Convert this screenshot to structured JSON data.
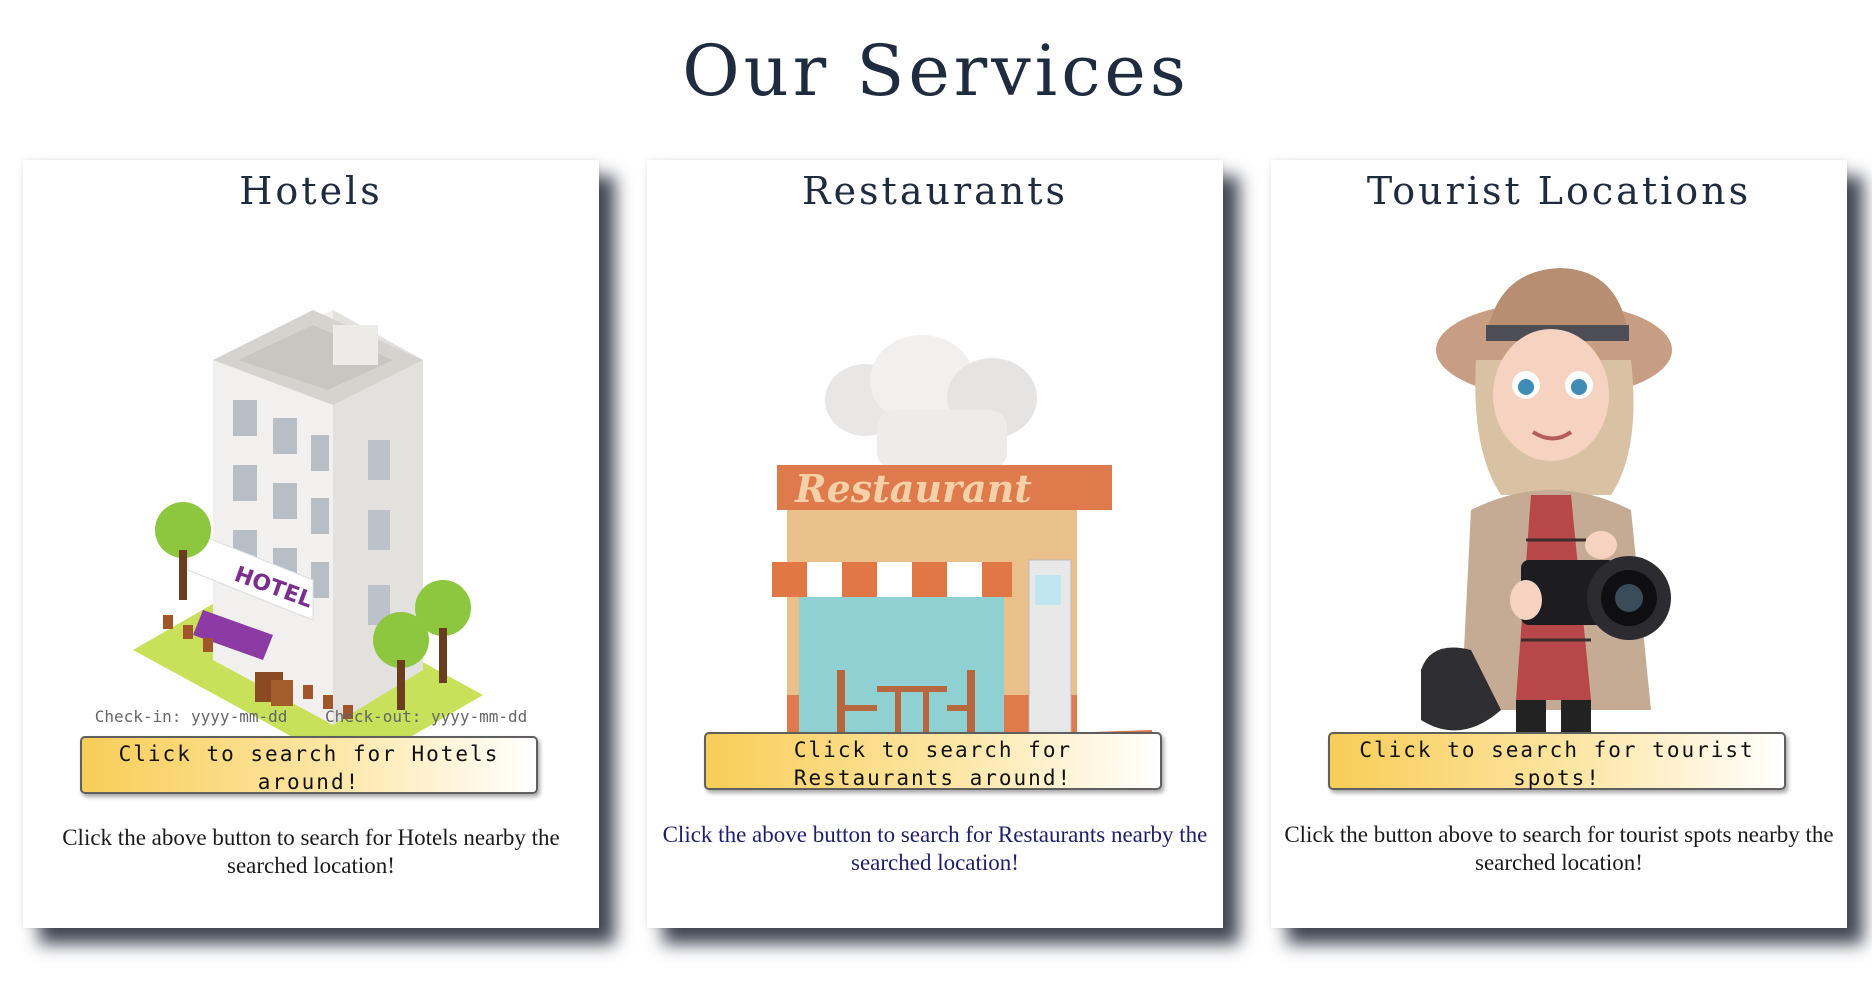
{
  "page": {
    "title": "Our Services"
  },
  "cards": [
    {
      "title": "Hotels",
      "image": "hotel-building-illustration",
      "checkin": "Check-in: yyyy-mm-dd",
      "checkout": "Check-out: yyyy-mm-dd",
      "button": "Click to search for Hotels around!",
      "description": "Click the above button to search for Hotels nearby the searched location!"
    },
    {
      "title": "Restaurants",
      "image": "restaurant-storefront-illustration",
      "sign": "Restaurant",
      "button": "Click to search for Restaurants around!",
      "description": "Click the above button to search for Restaurants nearby the searched location!"
    },
    {
      "title": "Tourist Locations",
      "image": "tourist-with-camera-illustration",
      "button": "Click to search for tourist spots!",
      "description": "Click the button above to search for tourist spots nearby the searched location!"
    }
  ],
  "colors": {
    "title": "#1f2b3f",
    "button_gradient_start": "#f8cd57",
    "button_gradient_end": "#ffffff",
    "card_shadow": "#1e2837"
  }
}
